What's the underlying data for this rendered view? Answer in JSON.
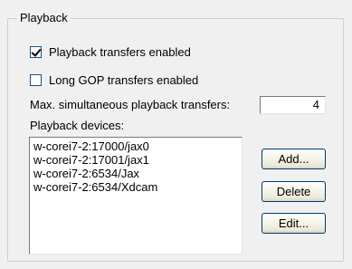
{
  "group": {
    "title": "Playback"
  },
  "options": {
    "playback_transfers": {
      "label": "Playback transfers enabled",
      "checked": true
    },
    "long_gop_transfers": {
      "label": "Long GOP transfers enabled",
      "checked": false
    }
  },
  "max_transfers": {
    "label": "Max. simultaneous playback transfers:",
    "value": "4"
  },
  "devices": {
    "label": "Playback devices:",
    "items": [
      "w-corei7-2:17000/jax0",
      "w-corei7-2:17001/jax1",
      "w-corei7-2:6534/Jax",
      "w-corei7-2:6534/Xdcam"
    ]
  },
  "buttons": {
    "add": "Add...",
    "delete": "Delete",
    "edit": "Edit..."
  }
}
